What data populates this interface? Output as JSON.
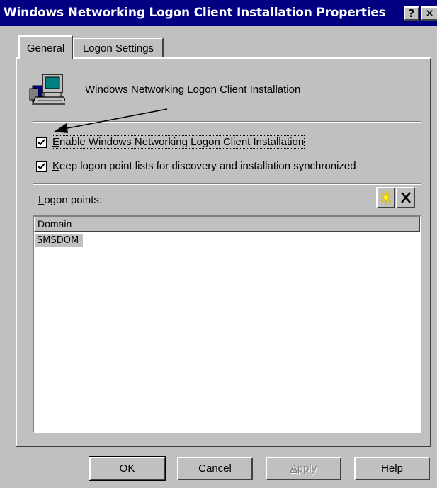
{
  "window": {
    "title": "Windows Networking Logon Client Installation Properties",
    "help_button": "?",
    "close_button": "✕"
  },
  "tabs": [
    {
      "label": "General",
      "selected": true
    },
    {
      "label": "Logon Settings",
      "selected": false
    }
  ],
  "header": {
    "icon": "computer-setup-icon",
    "text": "Windows Networking Logon Client Installation"
  },
  "options": {
    "enable": {
      "label_first": "E",
      "label_rest": "nable Windows Networking Logon Client Installation",
      "checked": true
    },
    "keep": {
      "label_first": "K",
      "label_rest": "eep logon point lists for discovery and installation synchronized",
      "checked": true
    }
  },
  "logon_points": {
    "label_first": "L",
    "label_rest": "ogon points:",
    "new_icon": "new-star-icon",
    "delete_icon": "delete-x-icon",
    "column": "Domain",
    "rows": [
      "SMSDOM"
    ]
  },
  "buttons": {
    "ok": "OK",
    "cancel": "Cancel",
    "apply_first": "A",
    "apply_rest": "pply",
    "help": "Help"
  },
  "colors": {
    "title_bar": "#000080",
    "face": "#c0c0c0",
    "star_icon": "#ffff00"
  }
}
